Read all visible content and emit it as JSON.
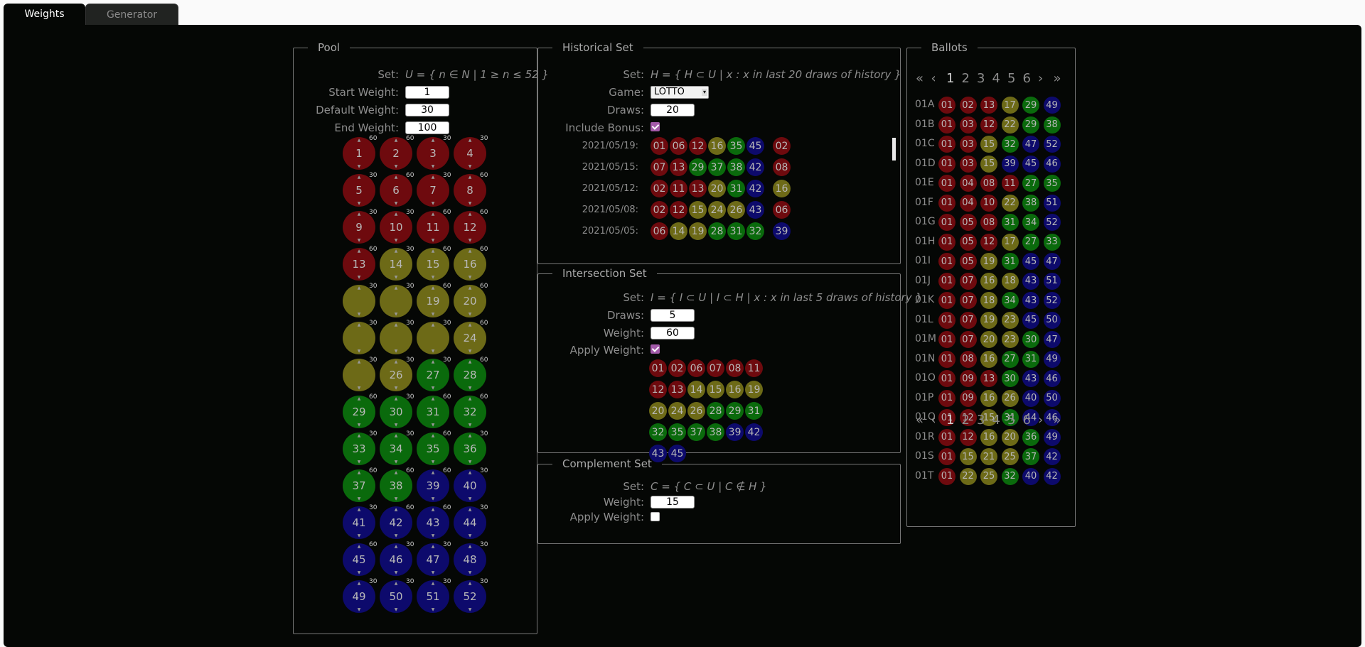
{
  "tabs": [
    {
      "label": "Weights"
    },
    {
      "label": "Generator"
    }
  ],
  "pool": {
    "legend": "Pool",
    "set_label": "Set:",
    "set_formula": "U = { n ∈ N | 1 ≥ n ≤ 52 }",
    "start_weight_label": "Start Weight:",
    "start_weight": "1",
    "default_weight_label": "Default Weight:",
    "default_weight": "30",
    "end_weight_label": "End Weight:",
    "end_weight": "100",
    "balls": [
      {
        "n": "1",
        "w": "60",
        "c": "red"
      },
      {
        "n": "2",
        "w": "60",
        "c": "red"
      },
      {
        "n": "3",
        "w": "30",
        "c": "red"
      },
      {
        "n": "4",
        "w": "30",
        "c": "red"
      },
      {
        "n": "5",
        "w": "30",
        "c": "red"
      },
      {
        "n": "6",
        "w": "60",
        "c": "red"
      },
      {
        "n": "7",
        "w": "30",
        "c": "red"
      },
      {
        "n": "8",
        "w": "60",
        "c": "red"
      },
      {
        "n": "9",
        "w": "30",
        "c": "red"
      },
      {
        "n": "10",
        "w": "30",
        "c": "red"
      },
      {
        "n": "11",
        "w": "60",
        "c": "red"
      },
      {
        "n": "12",
        "w": "60",
        "c": "red"
      },
      {
        "n": "13",
        "w": "60",
        "c": "red"
      },
      {
        "n": "14",
        "w": "30",
        "c": "yellow"
      },
      {
        "n": "15",
        "w": "60",
        "c": "yellow"
      },
      {
        "n": "16",
        "w": "60",
        "c": "yellow"
      },
      {
        "n": "",
        "w": "30",
        "c": "yellow"
      },
      {
        "n": "",
        "w": "30",
        "c": "yellow"
      },
      {
        "n": "19",
        "w": "60",
        "c": "yellow"
      },
      {
        "n": "20",
        "w": "60",
        "c": "yellow"
      },
      {
        "n": "",
        "w": "30",
        "c": "yellow"
      },
      {
        "n": "",
        "w": "30",
        "c": "yellow"
      },
      {
        "n": "",
        "w": "30",
        "c": "yellow"
      },
      {
        "n": "24",
        "w": "60",
        "c": "yellow"
      },
      {
        "n": "",
        "w": "30",
        "c": "yellow"
      },
      {
        "n": "26",
        "w": "30",
        "c": "yellow"
      },
      {
        "n": "27",
        "w": "30",
        "c": "green"
      },
      {
        "n": "28",
        "w": "60",
        "c": "green"
      },
      {
        "n": "29",
        "w": "60",
        "c": "green"
      },
      {
        "n": "30",
        "w": "30",
        "c": "green"
      },
      {
        "n": "31",
        "w": "60",
        "c": "green"
      },
      {
        "n": "32",
        "w": "60",
        "c": "green"
      },
      {
        "n": "33",
        "w": "30",
        "c": "green"
      },
      {
        "n": "34",
        "w": "30",
        "c": "green"
      },
      {
        "n": "35",
        "w": "60",
        "c": "green"
      },
      {
        "n": "36",
        "w": "30",
        "c": "green"
      },
      {
        "n": "37",
        "w": "60",
        "c": "green"
      },
      {
        "n": "38",
        "w": "60",
        "c": "green"
      },
      {
        "n": "39",
        "w": "60",
        "c": "blue"
      },
      {
        "n": "40",
        "w": "30",
        "c": "blue"
      },
      {
        "n": "41",
        "w": "30",
        "c": "blue"
      },
      {
        "n": "42",
        "w": "60",
        "c": "blue"
      },
      {
        "n": "43",
        "w": "60",
        "c": "blue"
      },
      {
        "n": "44",
        "w": "30",
        "c": "blue"
      },
      {
        "n": "45",
        "w": "60",
        "c": "blue"
      },
      {
        "n": "46",
        "w": "30",
        "c": "blue"
      },
      {
        "n": "47",
        "w": "30",
        "c": "blue"
      },
      {
        "n": "48",
        "w": "30",
        "c": "blue"
      },
      {
        "n": "49",
        "w": "30",
        "c": "blue"
      },
      {
        "n": "50",
        "w": "30",
        "c": "blue"
      },
      {
        "n": "51",
        "w": "30",
        "c": "blue"
      },
      {
        "n": "52",
        "w": "30",
        "c": "blue"
      }
    ]
  },
  "historical": {
    "legend": "Historical Set",
    "set_label": "Set:",
    "set_formula": "H = { H ⊂ U | x : x in last 20 draws of history }",
    "game_label": "Game:",
    "game_value": "LOTTO",
    "draws_label": "Draws:",
    "draws": "20",
    "bonus_label": "Include Bonus:",
    "draws_list": [
      {
        "date": "2021/05/19:",
        "balls": [
          "01",
          "06",
          "12",
          "16",
          "35",
          "45"
        ],
        "bonus": "02"
      },
      {
        "date": "2021/05/15:",
        "balls": [
          "07",
          "13",
          "29",
          "37",
          "38",
          "42"
        ],
        "bonus": "08"
      },
      {
        "date": "2021/05/12:",
        "balls": [
          "02",
          "11",
          "13",
          "20",
          "31",
          "42"
        ],
        "bonus": "16"
      },
      {
        "date": "2021/05/08:",
        "balls": [
          "02",
          "12",
          "15",
          "24",
          "26",
          "43"
        ],
        "bonus": "06"
      },
      {
        "date": "2021/05/05:",
        "balls": [
          "06",
          "14",
          "19",
          "28",
          "31",
          "32"
        ],
        "bonus": "39"
      }
    ]
  },
  "intersection": {
    "legend": "Intersection Set",
    "set_label": "Set:",
    "set_formula": "I = { I ⊂ U | I ⊂ H | x : x in last 5 draws of history }",
    "draws_label": "Draws:",
    "draws": "5",
    "weight_label": "Weight:",
    "weight": "60",
    "apply_label": "Apply Weight:",
    "balls": [
      "01",
      "02",
      "06",
      "07",
      "08",
      "11",
      "12",
      "13",
      "14",
      "15",
      "16",
      "19",
      "20",
      "24",
      "26",
      "28",
      "29",
      "31",
      "32",
      "35",
      "37",
      "38",
      "39",
      "42",
      "43",
      "45"
    ]
  },
  "complement": {
    "legend": "Complement Set",
    "set_label": "Set:",
    "set_formula": "C = { C ⊂ U | C ∉ H }",
    "weight_label": "Weight:",
    "weight": "15",
    "apply_label": "Apply Weight:"
  },
  "ballots": {
    "legend": "Ballots",
    "pager": [
      "«",
      "‹",
      "1",
      "2",
      "3",
      "4",
      "5",
      "6",
      "›",
      "»"
    ],
    "rows": [
      {
        "id": "01A",
        "balls": [
          "01",
          "02",
          "13",
          "17",
          "29",
          "49"
        ]
      },
      {
        "id": "01B",
        "balls": [
          "01",
          "03",
          "12",
          "22",
          "29",
          "38"
        ]
      },
      {
        "id": "01C",
        "balls": [
          "01",
          "03",
          "15",
          "32",
          "47",
          "52"
        ]
      },
      {
        "id": "01D",
        "balls": [
          "01",
          "03",
          "15",
          "39",
          "45",
          "46"
        ]
      },
      {
        "id": "01E",
        "balls": [
          "01",
          "04",
          "08",
          "11",
          "27",
          "35"
        ]
      },
      {
        "id": "01F",
        "balls": [
          "01",
          "04",
          "10",
          "22",
          "38",
          "51"
        ]
      },
      {
        "id": "01G",
        "balls": [
          "01",
          "05",
          "08",
          "31",
          "34",
          "52"
        ]
      },
      {
        "id": "01H",
        "balls": [
          "01",
          "05",
          "12",
          "17",
          "27",
          "33"
        ]
      },
      {
        "id": "01I",
        "balls": [
          "01",
          "05",
          "19",
          "31",
          "45",
          "47"
        ]
      },
      {
        "id": "01J",
        "balls": [
          "01",
          "07",
          "16",
          "18",
          "43",
          "51"
        ]
      },
      {
        "id": "01K",
        "balls": [
          "01",
          "07",
          "18",
          "34",
          "43",
          "52"
        ]
      },
      {
        "id": "01L",
        "balls": [
          "01",
          "07",
          "19",
          "23",
          "45",
          "50"
        ]
      },
      {
        "id": "01M",
        "balls": [
          "01",
          "07",
          "20",
          "23",
          "30",
          "47"
        ]
      },
      {
        "id": "01N",
        "balls": [
          "01",
          "08",
          "16",
          "27",
          "31",
          "49"
        ]
      },
      {
        "id": "01O",
        "balls": [
          "01",
          "09",
          "13",
          "30",
          "43",
          "46"
        ]
      },
      {
        "id": "01P",
        "balls": [
          "01",
          "09",
          "16",
          "26",
          "40",
          "50"
        ]
      },
      {
        "id": "01Q",
        "balls": [
          "01",
          "12",
          "15",
          "31",
          "44",
          "46"
        ]
      },
      {
        "id": "01R",
        "balls": [
          "01",
          "12",
          "16",
          "20",
          "36",
          "49"
        ]
      },
      {
        "id": "01S",
        "balls": [
          "01",
          "15",
          "21",
          "25",
          "37",
          "42"
        ]
      },
      {
        "id": "01T",
        "balls": [
          "01",
          "22",
          "25",
          "32",
          "40",
          "42"
        ]
      }
    ]
  },
  "colors": {
    "red": "#6e0a0e",
    "yellow": "#6d6a17",
    "green": "#0a6a0c",
    "blue": "#0d0a6c",
    "accent": "#a35aa9"
  }
}
